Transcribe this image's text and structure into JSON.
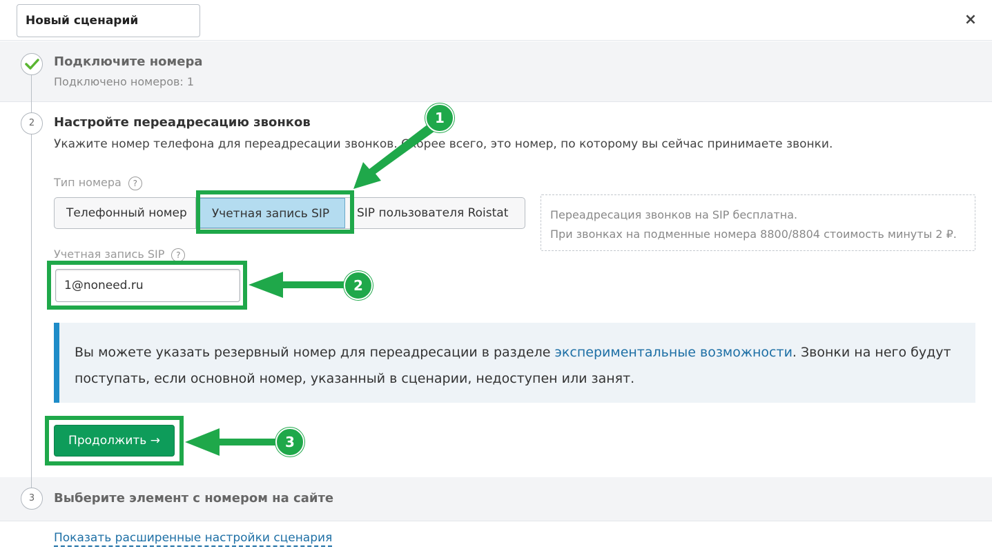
{
  "header": {
    "scenario_name": "Новый сценарий",
    "close_label": "×"
  },
  "steps": {
    "step1": {
      "title": "Подключите номера",
      "subtitle": "Подключено номеров: 1"
    },
    "step2": {
      "number": "2",
      "title": "Настройте переадресацию звонков",
      "description": "Укажите номер телефона для переадресации звонков. Скорее всего, это номер, по которому вы сейчас принимаете звонки."
    },
    "step3": {
      "number": "3",
      "title": "Выберите элемент с номером на сайте"
    }
  },
  "form": {
    "number_type_label": "Тип номера",
    "help_glyph": "?",
    "number_types": [
      "Телефонный номер",
      "Учетная запись SIP",
      "SIP пользователя Roistat"
    ],
    "selected_type": "Учетная запись SIP",
    "hint_line1": "Переадресация звонков на SIP бесплатна.",
    "hint_line2": "При звонках на подменные номера 8800/8804 стоимость минуты 2 ₽.",
    "sip_label": "Учетная запись SIP",
    "sip_value": "1@noneed.ru",
    "info_text_before": "Вы можете указать резервный номер для переадресации в разделе ",
    "info_link": "экспериментальные возможности",
    "info_text_after": ". Звонки на него будут поступать, если основной номер, указанный в сценарии, недоступен или занят.",
    "continue_label": "Продолжить →",
    "advanced_link": "Показать расширенные настройки сценария"
  },
  "annotations": {
    "badge1": "1",
    "badge2": "2",
    "badge3": "3",
    "color": "#1fa84a"
  },
  "colors": {
    "accent_button": "#0e9c5a",
    "selected_segment": "#b4dcf0",
    "info_border": "#1e8cc8",
    "link": "#1d6fa5"
  }
}
